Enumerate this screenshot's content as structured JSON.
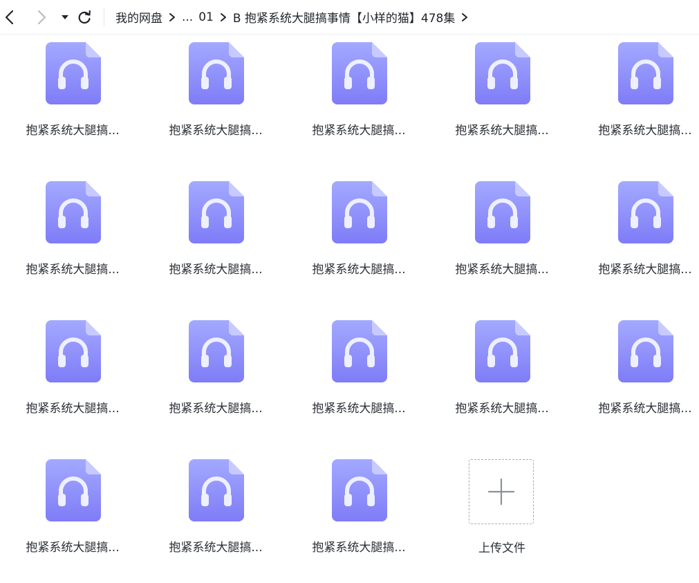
{
  "breadcrumb": {
    "root": "我的网盘",
    "ellipsis": "...",
    "folder1": "01",
    "folder2": "B 抱紧系统大腿搞事情【小样的猫】478集"
  },
  "files": [
    {
      "name": "抱紧系统大腿搞...",
      "icon": "audio-file-icon"
    },
    {
      "name": "抱紧系统大腿搞...",
      "icon": "audio-file-icon"
    },
    {
      "name": "抱紧系统大腿搞...",
      "icon": "audio-file-icon"
    },
    {
      "name": "抱紧系统大腿搞...",
      "icon": "audio-file-icon"
    },
    {
      "name": "抱紧系统大腿搞...",
      "icon": "audio-file-icon"
    },
    {
      "name": "抱紧系统大腿搞...",
      "icon": "audio-file-icon"
    },
    {
      "name": "抱紧系统大腿搞...",
      "icon": "audio-file-icon"
    },
    {
      "name": "抱紧系统大腿搞...",
      "icon": "audio-file-icon"
    },
    {
      "name": "抱紧系统大腿搞...",
      "icon": "audio-file-icon"
    },
    {
      "name": "抱紧系统大腿搞...",
      "icon": "audio-file-icon"
    },
    {
      "name": "抱紧系统大腿搞...",
      "icon": "audio-file-icon"
    },
    {
      "name": "抱紧系统大腿搞...",
      "icon": "audio-file-icon"
    },
    {
      "name": "抱紧系统大腿搞...",
      "icon": "audio-file-icon"
    },
    {
      "name": "抱紧系统大腿搞...",
      "icon": "audio-file-icon"
    },
    {
      "name": "抱紧系统大腿搞...",
      "icon": "audio-file-icon"
    },
    {
      "name": "抱紧系统大腿搞...",
      "icon": "audio-file-icon"
    },
    {
      "name": "抱紧系统大腿搞...",
      "icon": "audio-file-icon"
    },
    {
      "name": "抱紧系统大腿搞...",
      "icon": "audio-file-icon"
    }
  ],
  "upload": {
    "label": "上传文件"
  },
  "colors": {
    "icon_top": "#a3a9ff",
    "icon_bottom": "#7f7cf7",
    "icon_fold": "#c7caff"
  }
}
